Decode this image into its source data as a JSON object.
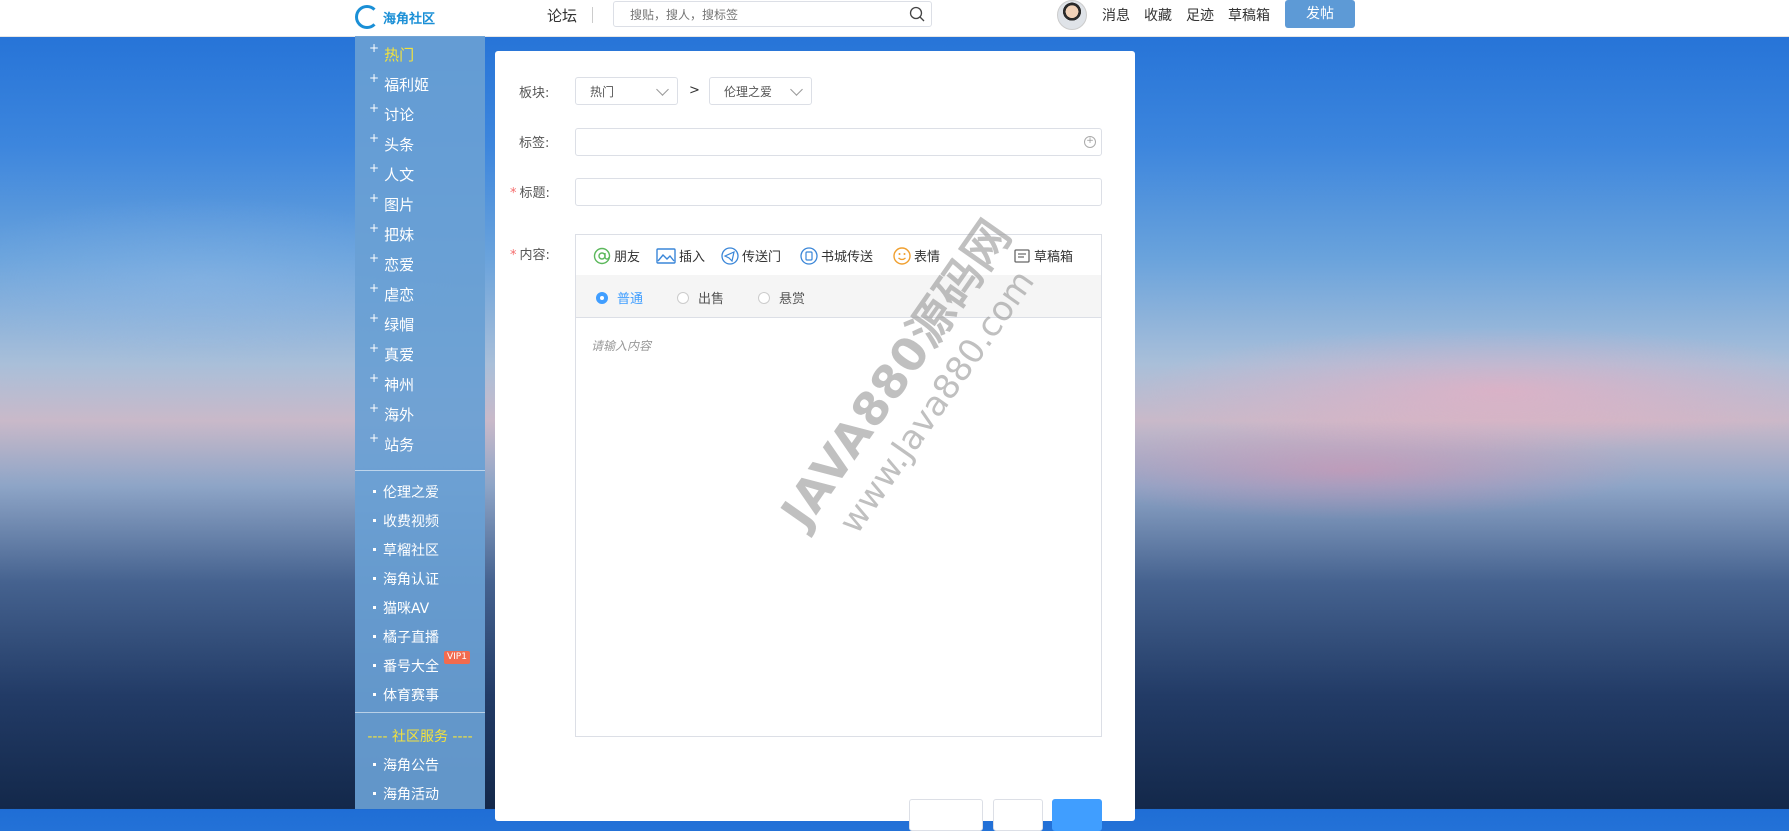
{
  "header": {
    "logo_text": "海角社区",
    "forum_label": "论坛",
    "search_placeholder": "搜贴，搜人，搜标签",
    "nav": [
      "消息",
      "收藏",
      "足迹",
      "草稿箱"
    ],
    "post_button": "发帖"
  },
  "sidebar": {
    "categories": [
      "热门",
      "福利姬",
      "讨论",
      "头条",
      "人文",
      "图片",
      "把妹",
      "恋爱",
      "虐恋",
      "绿帽",
      "真爱",
      "神州",
      "海外",
      "站务"
    ],
    "links": [
      "伦理之爱",
      "收费视频",
      "草榴社区",
      "海角认证",
      "猫咪AV",
      "橘子直播",
      "番号大全",
      "体育赛事"
    ],
    "vip_badge": "VIP1",
    "service_heading": "---- 社区服务 ----",
    "service_links": [
      "海角公告",
      "海角活动"
    ]
  },
  "form": {
    "board_label": "板块:",
    "board_select": "热门",
    "separator": ">",
    "sub_board_select": "伦理之爱",
    "tags_label": "标签:",
    "title_required": "*",
    "title_label": "标题:",
    "content_required": "*",
    "content_label": "内容:",
    "toolbar": [
      "朋友",
      "插入",
      "传送门",
      "书城传送",
      "表情",
      "草稿箱"
    ],
    "post_types": [
      "普通",
      "出售",
      "悬赏"
    ],
    "content_placeholder": "请输入内容"
  },
  "watermark": {
    "line1": "JAVA880源码网",
    "line2": "www.Java880.com"
  },
  "colors": {
    "accent": "#409eff",
    "sidebar_bg": "#69a0d4",
    "highlight": "#f3e23c",
    "post_button_bg": "#5d9ad6",
    "required": "#f56c6c"
  }
}
